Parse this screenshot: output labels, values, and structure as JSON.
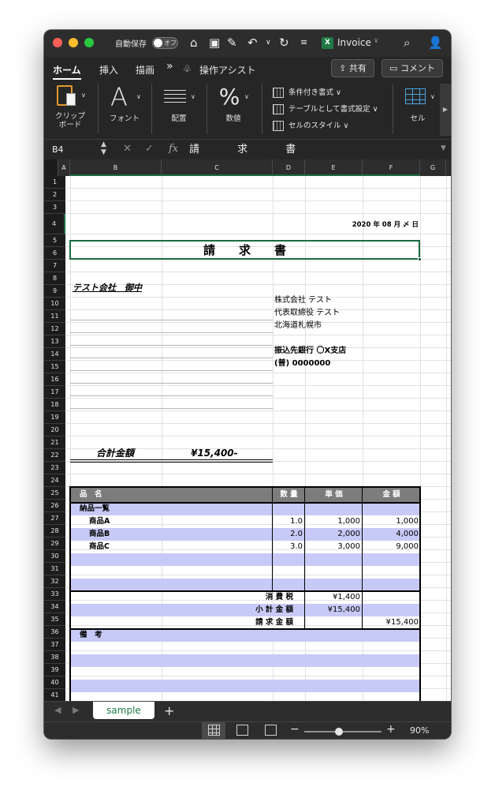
{
  "titlebar": {
    "autosave_label": "自動保存",
    "autosave_state": "オフ",
    "doc_title": "Invoice",
    "icons": [
      "home-icon",
      "save-icon",
      "edit-icon",
      "undo-icon",
      "redo-icon",
      "customize-icon",
      "search-icon",
      "share-person-icon"
    ]
  },
  "ribbon_tabs": [
    "ホーム",
    "挿入",
    "描画",
    "操作アシスト"
  ],
  "ribbon_more": "»",
  "buttons": {
    "share": "共有",
    "comment": "コメント"
  },
  "ribbon": {
    "clipboard": "クリップ\nボード",
    "font": "フォント",
    "alignment": "配置",
    "number": "数値",
    "styles": [
      "条件付き書式",
      "テーブルとして書式設定",
      "セルのスタイル"
    ],
    "cells": "セル"
  },
  "formula_bar": {
    "name_box": "B4",
    "fx": "fx",
    "value": "請 求 書"
  },
  "columns": [
    "A",
    "B",
    "C",
    "D",
    "E",
    "F",
    "G"
  ],
  "sheet": {
    "date": "2020 年 08 月 〆 日",
    "title": "請　　求　　書",
    "addressee": "テスト会社　御中",
    "issuer": [
      "株式会社 テスト",
      "代表取締役 テスト",
      "北海道札幌市"
    ],
    "bank": [
      "振込先銀行 〇X支店",
      "(普) 0000000"
    ],
    "total_label": "合計金額",
    "total_value": "¥15,400-",
    "headers": {
      "item": "品　名",
      "qty": "数 量",
      "price": "単 価",
      "amount": "金 額"
    },
    "section_label": "納品一覧",
    "items": [
      {
        "name": "商品A",
        "qty": "1.0",
        "price": "1,000",
        "amount": "1,000"
      },
      {
        "name": "商品B",
        "qty": "2.0",
        "price": "2,000",
        "amount": "4,000"
      },
      {
        "name": "商品C",
        "qty": "3.0",
        "price": "3,000",
        "amount": "9,000"
      }
    ],
    "summary": {
      "tax_label": "消 費 税",
      "tax_value": "¥1,400",
      "subtotal_label": "小 計 金 額",
      "subtotal_value": "¥15,400",
      "invoice_label": "請 求 金 額",
      "invoice_value": "¥15,400"
    },
    "notes_label": "備　考"
  },
  "sheet_tab": "sample",
  "status": {
    "zoom_level": 0.45,
    "zoom": "90%"
  }
}
